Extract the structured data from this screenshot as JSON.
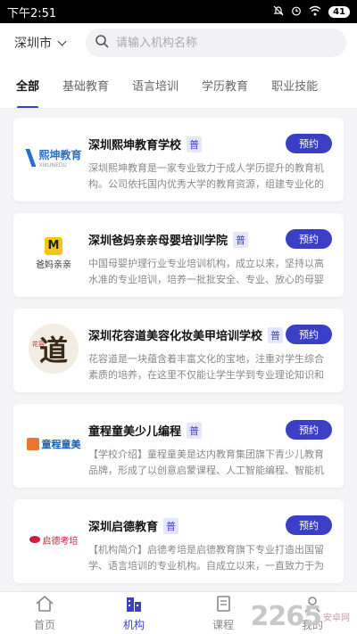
{
  "status_bar": {
    "time": "下午2:51",
    "battery": "41"
  },
  "header": {
    "city": "深圳市",
    "search_placeholder": "请输入机构名称"
  },
  "tabs": [
    {
      "label": "全部",
      "active": true
    },
    {
      "label": "基础教育",
      "active": false
    },
    {
      "label": "语言培训",
      "active": false
    },
    {
      "label": "学历教育",
      "active": false
    },
    {
      "label": "职业技能",
      "active": false
    }
  ],
  "institutions": [
    {
      "name": "深圳熙坤教育学校",
      "badge": "普",
      "button": "预约",
      "logo_text": "熙坤教育",
      "logo_sub": "XIKUNEDU",
      "description": "深圳熙坤教育是一家专业致力于成人学历提升的教育机构。公司依托国内优秀大学的教育资源，组建专业化的师资团队……"
    },
    {
      "name": "深圳爸妈亲亲母婴培训学院",
      "badge": "普",
      "button": "预约",
      "logo_text": "爸妈亲亲",
      "logo_sub": "M",
      "description": "中国母婴护理行业专业培训机构，成立以来，坚持以高水准的专业培训，培养一批批安全、专业、放心的母婴护理师，……"
    },
    {
      "name": "深圳花容道美容化妆美甲培训学校",
      "badge": "普",
      "button": "预约",
      "logo_text": "道",
      "logo_sub": "花容",
      "description": "花容道是一块蕴含着丰富文化的宝地，注重对学生综合素质的培养，在这里不仅能让学生学到专业理论知识和实操技能……"
    },
    {
      "name": "童程童美少儿编程",
      "badge": "普",
      "button": "预约",
      "logo_text": "童程童美",
      "logo_sub": "",
      "description": "【学校介绍】童程童美是达内教育集团旗下青少儿教育品牌，形成了以创意启蒙课程、人工智能编程、智能机器人……"
    },
    {
      "name": "深圳启德教育",
      "badge": "普",
      "button": "预约",
      "logo_text": "启德考培",
      "logo_sub": "",
      "description": "【机构简介】启德考培是启德教育旗下专业打造出国留学、语言培训的专业机构。自成立以来，一直致力于为中国学……"
    }
  ],
  "bottom_nav": [
    {
      "label": "首页",
      "icon": "home-icon",
      "active": false
    },
    {
      "label": "机构",
      "icon": "building-icon",
      "active": true
    },
    {
      "label": "课程",
      "icon": "book-icon",
      "active": false
    },
    {
      "label": "我的",
      "icon": "user-icon",
      "active": false
    }
  ],
  "watermark": {
    "number": "2265",
    "text": "安卓网"
  },
  "colors": {
    "accent": "#3b3fc6",
    "badge_bg": "#e6e6fa"
  }
}
